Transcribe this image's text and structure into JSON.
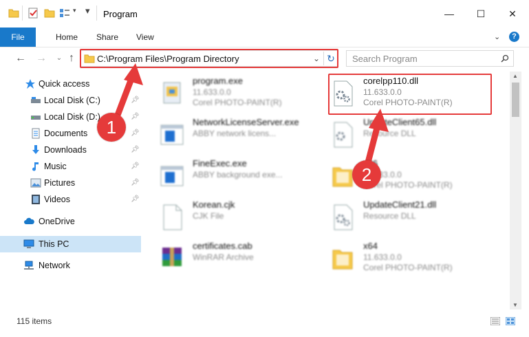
{
  "window": {
    "title": "Program",
    "minimize_glyph": "—",
    "maximize_glyph": "☐",
    "close_glyph": "✕"
  },
  "ribbon": {
    "tabs": [
      "File",
      "Home",
      "Share",
      "View"
    ],
    "help_glyph": "?"
  },
  "address": {
    "path": "C:\\Program Files\\Program Directory",
    "search_placeholder": "Search Program"
  },
  "sidebar": {
    "items": [
      {
        "label": "Quick access",
        "icon": "star-icon",
        "pinned": false
      },
      {
        "label": "Local Disk (C:)",
        "icon": "drive-icon",
        "pinned": true
      },
      {
        "label": "Local Disk (D:)",
        "icon": "drive-icon",
        "pinned": true
      },
      {
        "label": "Documents",
        "icon": "document-icon",
        "pinned": true
      },
      {
        "label": "Downloads",
        "icon": "download-icon",
        "pinned": true
      },
      {
        "label": "Music",
        "icon": "music-icon",
        "pinned": true
      },
      {
        "label": "Pictures",
        "icon": "picture-icon",
        "pinned": true
      },
      {
        "label": "Videos",
        "icon": "video-icon",
        "pinned": true
      },
      {
        "label": "OneDrive",
        "icon": "cloud-icon",
        "pinned": false
      },
      {
        "label": "This PC",
        "icon": "computer-icon",
        "pinned": false,
        "selected": true
      },
      {
        "label": "Network",
        "icon": "network-icon",
        "pinned": false
      }
    ]
  },
  "files": [
    {
      "name": "program.exe",
      "line1": "11.633.0.0",
      "line2": "Corel PHOTO-PAINT(R)",
      "icon": "exe-icon"
    },
    {
      "name": "corelpp110.dll",
      "line1": "11.633.0.0",
      "line2": "Corel PHOTO-PAINT(R)",
      "icon": "dll-gear-icon"
    },
    {
      "name": "NetworkLicenseServer.exe",
      "line1": "ABBY network licens...",
      "line2": "",
      "icon": "window-app-icon"
    },
    {
      "name": "UpdateClient65.dll",
      "line1": "Resource DLL",
      "line2": "",
      "icon": "dll-gear-icon"
    },
    {
      "name": "FineExec.exe",
      "line1": "ABBY background exe...",
      "line2": "",
      "icon": "window-app-icon"
    },
    {
      "name": "x86",
      "line1": "11.633.0.0",
      "line2": "Corel PHOTO-PAINT(R)",
      "icon": "folder-file-icon"
    },
    {
      "name": "Korean.cjk",
      "line1": "CJK File",
      "line2": "",
      "icon": "blank-file-icon"
    },
    {
      "name": "UpdateClient21.dll",
      "line1": "Resource DLL",
      "line2": "",
      "icon": "dll-gear-icon"
    },
    {
      "name": "certificates.cab",
      "line1": "WinRAR Archive",
      "line2": "",
      "icon": "winrar-icon"
    },
    {
      "name": "x64",
      "line1": "11.633.0.0",
      "line2": "Corel PHOTO-PAINT(R)",
      "icon": "folder-file-icon"
    }
  ],
  "status": {
    "item_count": "115 items"
  },
  "callouts": [
    {
      "number": "1"
    },
    {
      "number": "2"
    }
  ],
  "colors": {
    "accent": "#1979ca",
    "highlight": "#e53a3a",
    "selected": "#cce4f7"
  }
}
